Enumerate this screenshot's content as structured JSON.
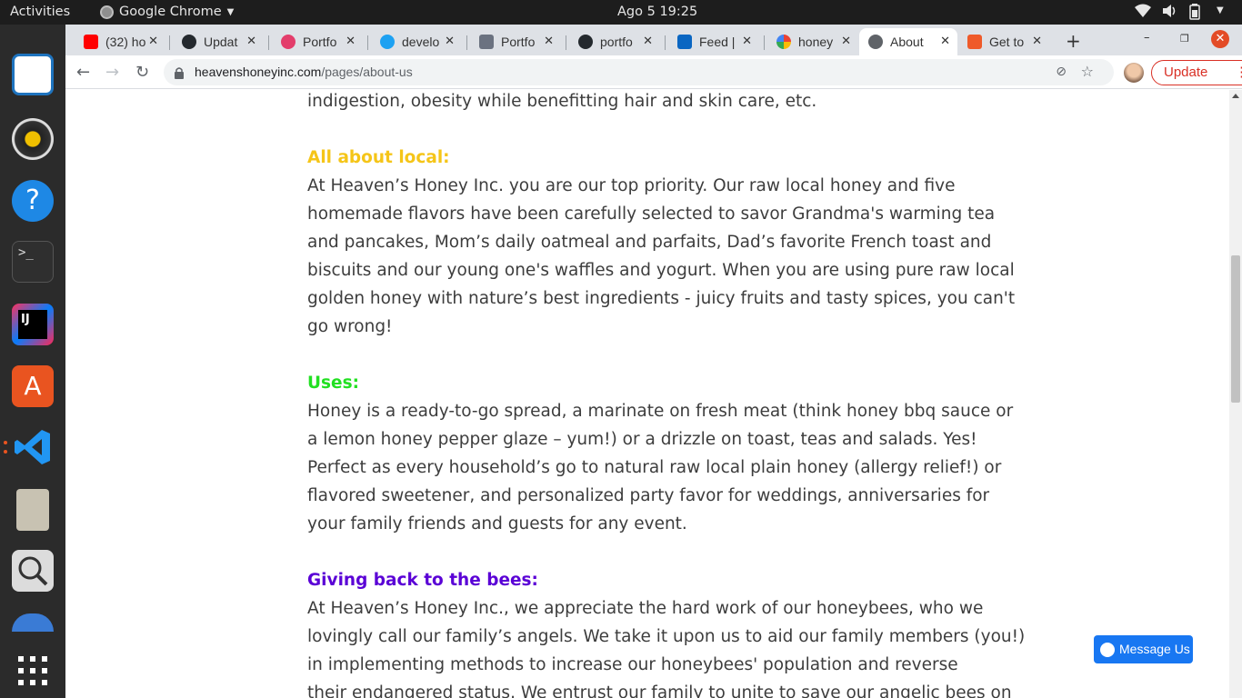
{
  "topbar": {
    "activities": "Activities",
    "app_name": "Google Chrome",
    "clock": "Ago 5  19:25"
  },
  "tabs": [
    {
      "title": "(32) ho",
      "icon": "youtube-icon",
      "color": "#ff0000"
    },
    {
      "title": "Updat",
      "icon": "github-icon",
      "color": "#24292e"
    },
    {
      "title": "Portfo",
      "icon": "portfolio-icon",
      "color": "#e33d6b"
    },
    {
      "title": "develo",
      "icon": "twitter-icon",
      "color": "#1da1f2"
    },
    {
      "title": "Portfo",
      "icon": "portfolio-icon",
      "color": "#6b7280"
    },
    {
      "title": "portfo",
      "icon": "github-icon",
      "color": "#24292e"
    },
    {
      "title": "Feed |",
      "icon": "linkedin-icon",
      "color": "#0a66c2"
    },
    {
      "title": "honey",
      "icon": "google-icon",
      "color": "#4285f4"
    },
    {
      "title": "About",
      "icon": "globe-icon",
      "color": "#5f6368"
    },
    {
      "title": "Get to",
      "icon": "hackerrank-icon",
      "color": "#ef5a2a"
    }
  ],
  "active_tab_index": 8,
  "address_bar": {
    "domain": "heavenshoneyinc.com",
    "path": "/pages/about-us"
  },
  "update_label": "Update",
  "article": {
    "intro_tail": "indigestion, obesity while benefitting hair and skin care, etc.",
    "local_heading": "All about local:",
    "local_lines": [
      "At Heaven’s Honey Inc. you are our top priority. Our raw local honey and five",
      "homemade flavors have been carefully selected to savor Grandma's warming tea",
      "and pancakes, Mom’s daily oatmeal and parfaits, Dad’s favorite French toast and",
      "biscuits and our young one's waffles and yogurt. When you are using pure raw local",
      "golden honey with nature’s best ingredients - juicy fruits and tasty spices, you can't",
      "go wrong!"
    ],
    "uses_heading": "Uses:",
    "uses_lines": [
      "Honey is a ready-to-go spread, a marinate on fresh meat (think honey bbq sauce or",
      "a lemon honey pepper glaze – yum!) or a drizzle on toast, teas and salads. Yes!",
      "Perfect as every household’s go to natural raw local plain honey (allergy relief!) or",
      "flavored sweetener, and personalized party favor for weddings, anniversaries for",
      "your family friends and guests for any event."
    ],
    "bees_heading": "Giving back to the bees:",
    "bees_lines": [
      "At Heaven’s Honey Inc., we appreciate the hard work of our honeybees, who we",
      "lovingly call our family’s angels. We take it upon us to aid our family members (you!)",
      "in implementing methods to increase our honeybees' population and reverse",
      "their endangered status. We entrust our family to unite to save our angelic bees on"
    ]
  },
  "colors": {
    "local_heading": "#f5c518",
    "uses_heading": "#22e022",
    "bees_heading": "#5a00d6"
  },
  "messenger_label": "Message Us"
}
